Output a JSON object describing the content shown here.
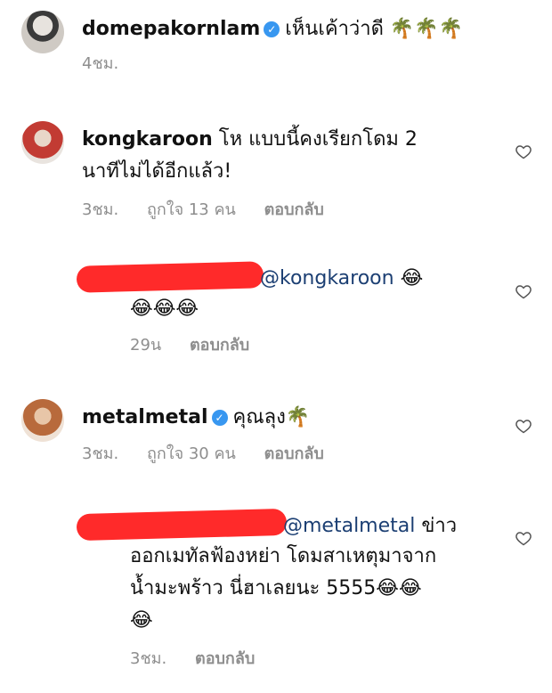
{
  "post": {
    "username": "domepakornlam",
    "caption": "เห็นเค้าว่าดี 🌴🌴🌴",
    "time": "4ชม."
  },
  "comments": [
    {
      "username": "kongkaroon",
      "text_line1": "โห แบบนี้คงเรียกโดม 2",
      "text_line2": "นาทีไม่ได้อีกแล้ว!",
      "time": "3ชม.",
      "likes": "ถูกใจ 13 คน",
      "reply": "ตอบกลับ"
    },
    {
      "mention": "@kongkaroon",
      "trailing": "😂",
      "text_line2": "😂😂😂",
      "time": "29น",
      "reply": "ตอบกลับ"
    },
    {
      "username": "metalmetal",
      "text": "คุณลุง🌴",
      "time": "3ชม.",
      "likes": "ถูกใจ 30 คน",
      "reply": "ตอบกลับ"
    },
    {
      "mention": "@metalmetal",
      "trailing": "ข่าว",
      "text_line2": "ออกเมทัลฟ้องหย่า โดมสาเหตุมาจาก",
      "text_line3": "น้ำมะพร้าว นี่ฮาเลยนะ 5555😂😂",
      "text_line4": "😂",
      "time": "3ชม.",
      "reply": "ตอบกลับ"
    }
  ],
  "colors": {
    "mention": "#1c3f73",
    "verified": "#3897f0",
    "redaction": "#ff2a2a"
  }
}
